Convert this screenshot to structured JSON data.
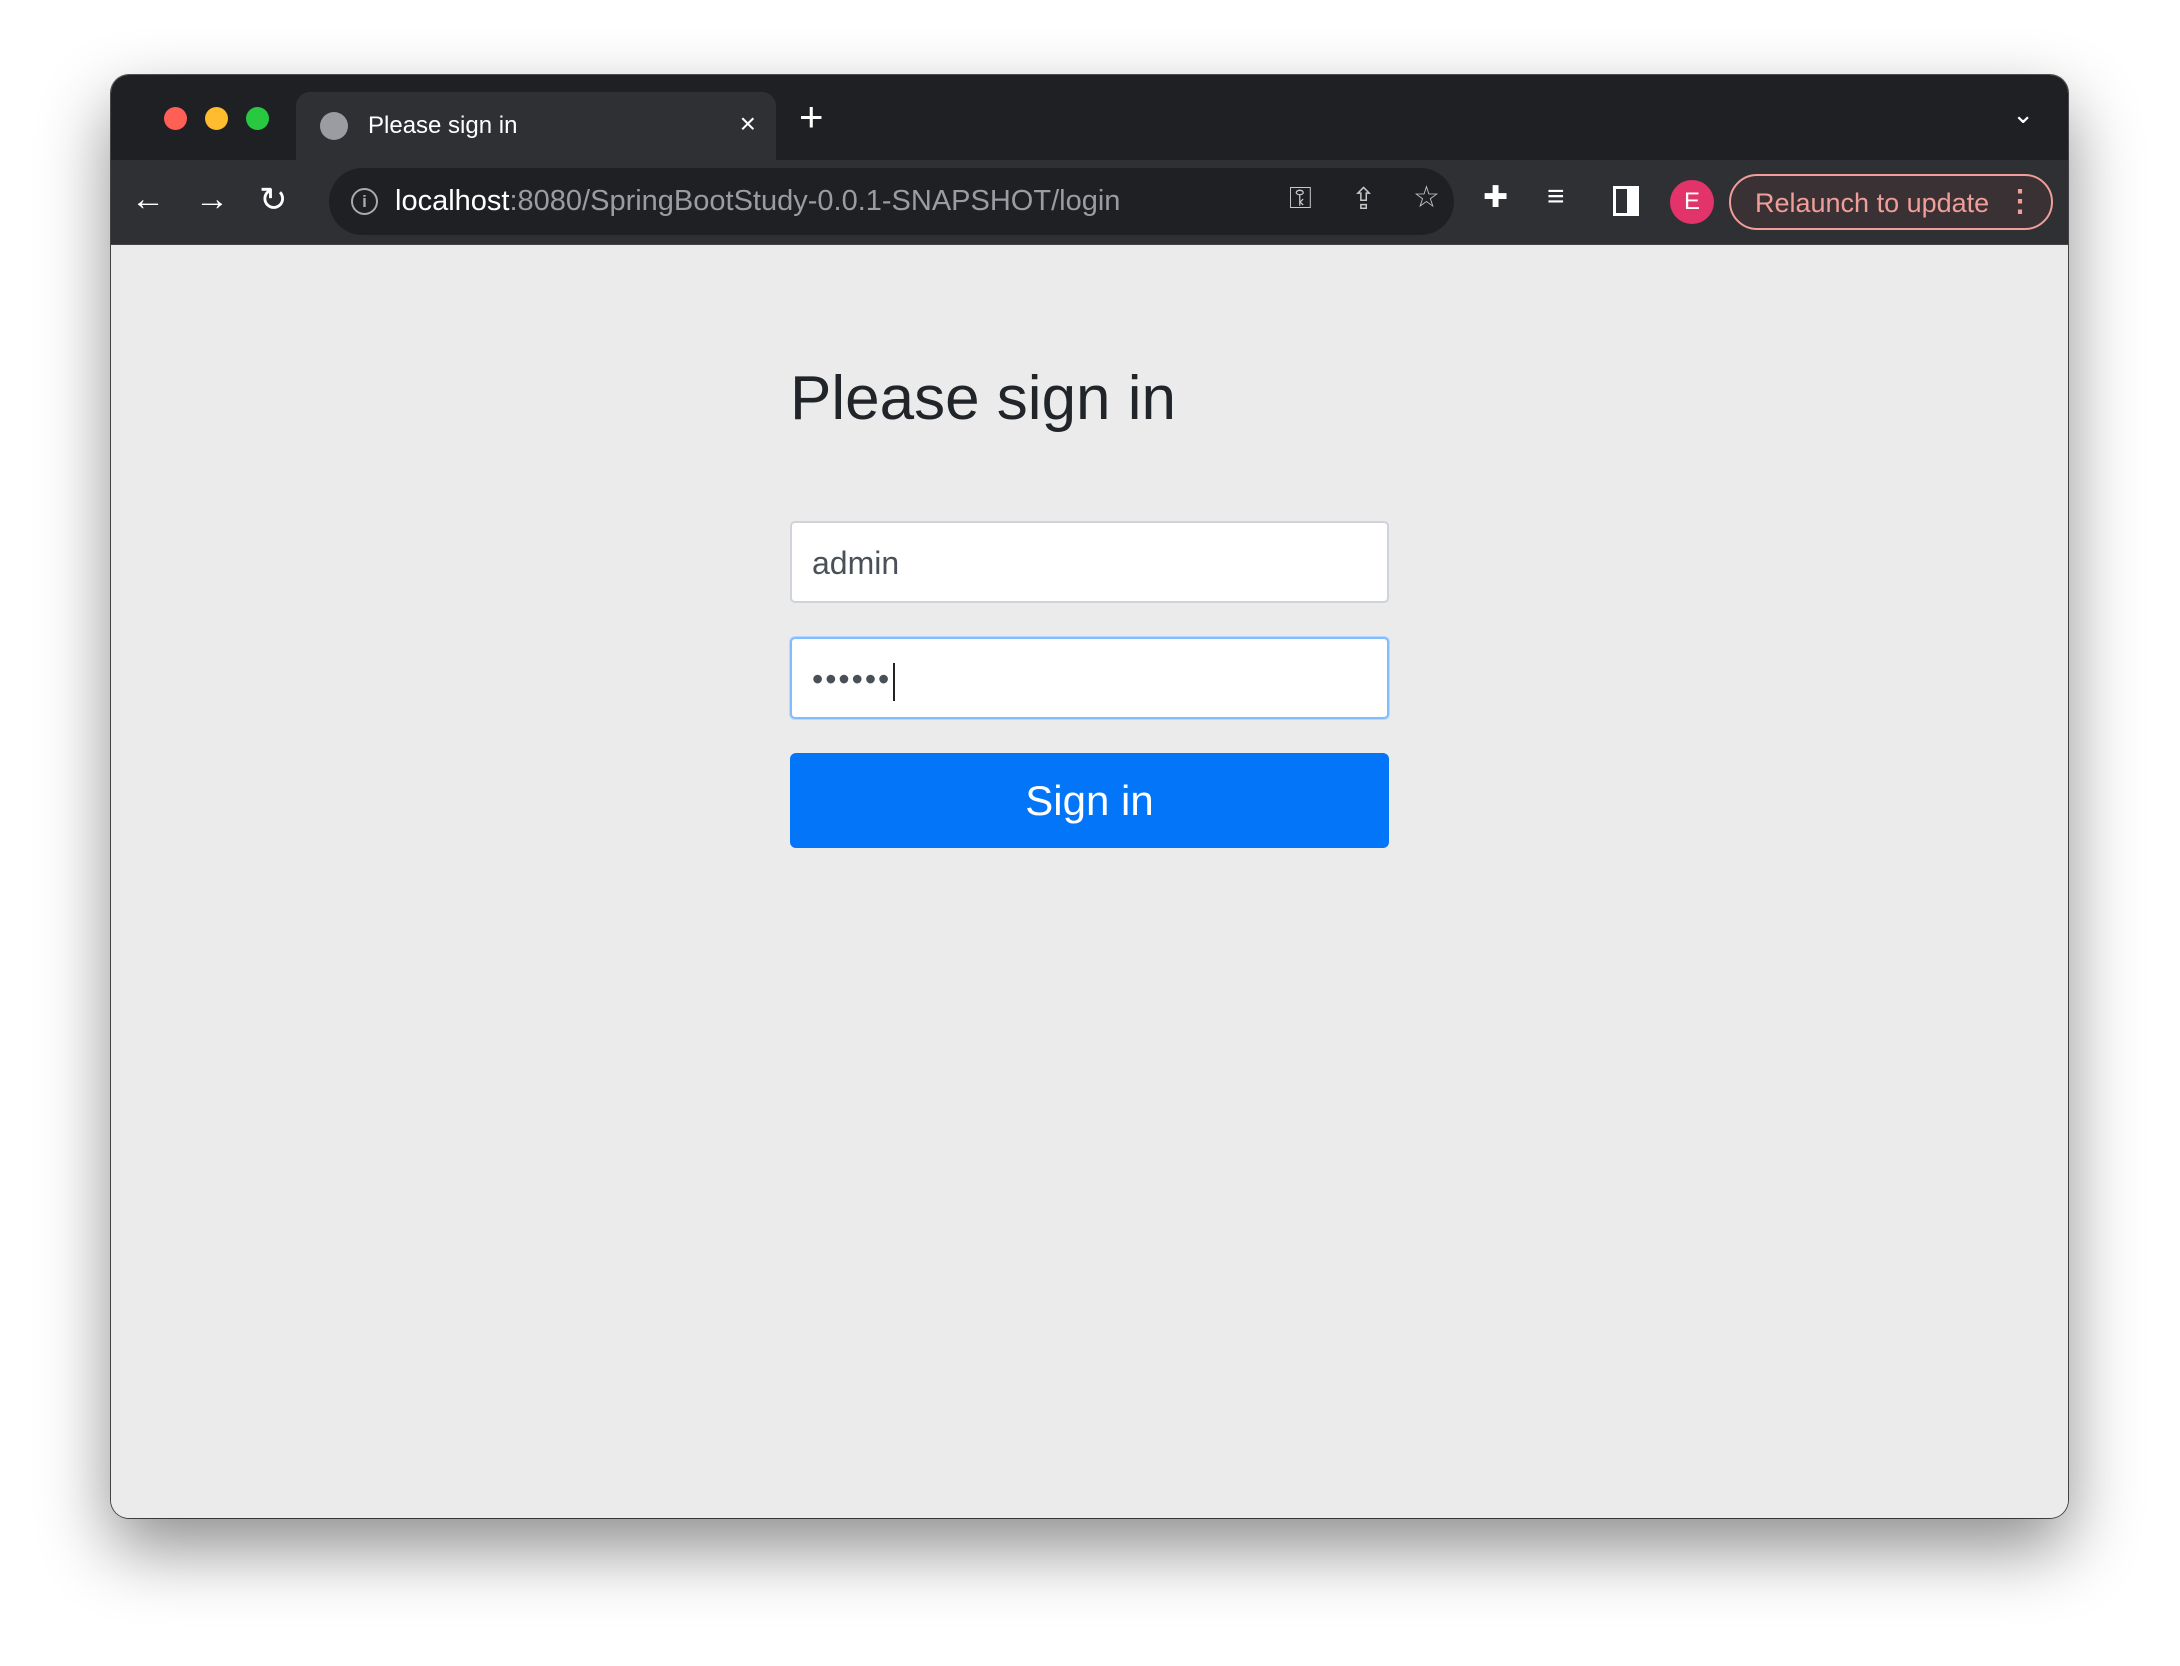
{
  "browser": {
    "tab_title": "Please sign in",
    "tab_close": "×",
    "new_tab": "+",
    "tab_list": "⌄",
    "url_host": "localhost",
    "url_rest": ":8080/SpringBootStudy-0.0.1-SNAPSHOT/login",
    "profile_initial": "E",
    "relaunch_label": "Relaunch to update",
    "menu": "⋮",
    "colors": {
      "close": "#ff5f57",
      "minimize": "#febc2e",
      "zoom": "#28c840",
      "avatar": "#e2336b",
      "relaunch": "#f19d98"
    }
  },
  "page": {
    "heading": "Please sign in",
    "username_value": "admin",
    "password_masked": "••••••",
    "submit_label": "Sign in",
    "accent": "#0275f8"
  }
}
